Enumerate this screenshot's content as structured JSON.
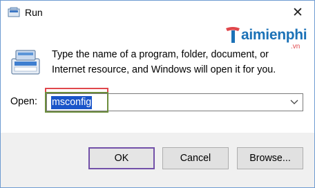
{
  "window": {
    "title": "Run",
    "close_glyph": "✕"
  },
  "watermark": {
    "brand": "aimienphi",
    "suffix": ".vn"
  },
  "prompt": {
    "line1": "Type the name of a program, folder, document, or",
    "line2": "Internet resource, and Windows will open it for you."
  },
  "open": {
    "label": "Open:",
    "value": "msconfig"
  },
  "buttons": {
    "ok": "OK",
    "cancel": "Cancel",
    "browse": "Browse..."
  },
  "colors": {
    "selection": "#1a55c9",
    "highlight_red": "#e0474c",
    "highlight_green": "#6c8d3c",
    "default_button_border": "#7250a8",
    "brand_blue": "#1c72b7"
  },
  "icons": {
    "title": "run-icon",
    "prompt": "run-large-icon",
    "dropdown": "chevron-down-icon",
    "close": "close-icon"
  }
}
